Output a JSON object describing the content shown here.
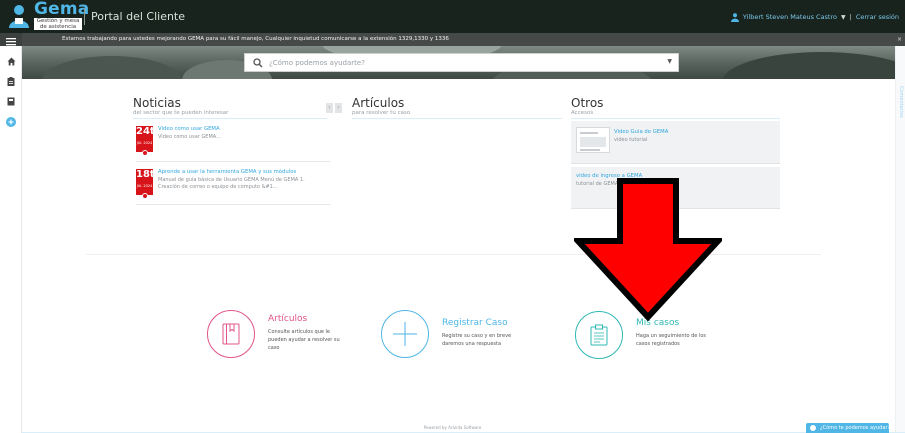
{
  "app": {
    "logo_title": "Gema",
    "logo_subtitle": "Gestión y mesa de asistencia",
    "portal_title": "Portal del Cliente",
    "user_name": "Yilbert Steven Mateus Castro",
    "logout_label": "Cerrar sesión"
  },
  "announcement": {
    "text": "Estamos trabajando para ustedes mejorando GEMA para su fácil manejo, Cualquier inquietud comunicarse a la extensión 1329,1330 y 1336",
    "close_label": "×"
  },
  "search": {
    "placeholder": "¿Cómo podemos ayudarte?"
  },
  "noticias": {
    "title": "Noticias",
    "subtitle": "del sector que te pueden interesar",
    "items": [
      {
        "day": "24t",
        "month_line": "JUL 2024",
        "title": "Video como usar GEMA",
        "desc": "Video como usar GEMA..."
      },
      {
        "day": "18t",
        "month_line": "JUL 2024",
        "title": "Aprende a usar la herramienta GEMA y sus módulos",
        "desc": "Manual de guía básica de Usuario GEMA Menú de GEMA 1.",
        "desc2": "Creación de correo o equipo de computo &#1..."
      }
    ]
  },
  "articulos": {
    "title": "Artículos",
    "subtitle": "para resolver tu caso"
  },
  "otros": {
    "title": "Otros",
    "subtitle": "Accesos",
    "items": [
      {
        "title": "Video Guia de GEMA",
        "desc": "video tutorial"
      },
      {
        "title": "video de ingreso a GEMA",
        "desc": "tutorial de GEMA"
      }
    ]
  },
  "tiles": [
    {
      "title": "Artículos",
      "desc": "Consulte artículos que le pueden ayudar a resolver su caso",
      "color": "#e0548a"
    },
    {
      "title": "Registrar Caso",
      "desc": "Registre su caso y en breve daremos una respuesta",
      "color": "#4fb6e6"
    },
    {
      "title": "Mis casos",
      "desc": "Haga un seguimiento de los casos registrados",
      "color": "#2fb8b3"
    }
  ],
  "footer": {
    "powered": "Powered by Aranda Software",
    "help_label": "¿Cómo te podemos ayudar?"
  },
  "side_feedback": "Comentarios"
}
